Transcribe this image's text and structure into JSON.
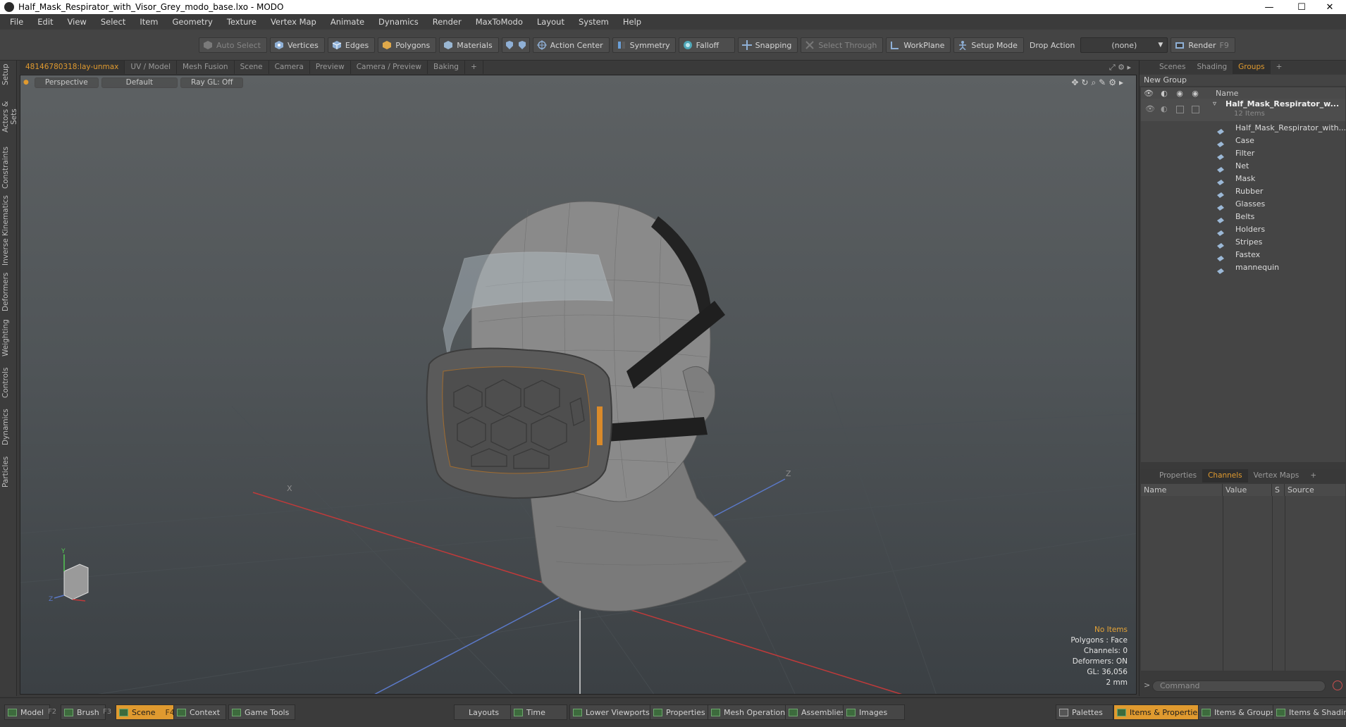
{
  "window": {
    "title": "Half_Mask_Respirator_with_Visor_Grey_modo_base.lxo - MODO",
    "minimize": "—",
    "maximize": "☐",
    "close": "✕"
  },
  "menu": [
    "File",
    "Edit",
    "View",
    "Select",
    "Item",
    "Geometry",
    "Texture",
    "Vertex Map",
    "Animate",
    "Dynamics",
    "Render",
    "MaxToModo",
    "Layout",
    "System",
    "Help"
  ],
  "toolbar": {
    "auto_select": "Auto Select",
    "vertices": "Vertices",
    "edges": "Edges",
    "polygons": "Polygons",
    "materials": "Materials",
    "action_center": "Action Center",
    "symmetry": "Symmetry",
    "falloff": "Falloff",
    "snapping": "Snapping",
    "select_through": "Select Through",
    "workplane": "WorkPlane",
    "setup_mode": "Setup Mode",
    "drop_action_label": "Drop Action",
    "drop_action_value": "(none)",
    "render": "Render",
    "render_key": "F9"
  },
  "left_tabs": [
    "Setup",
    "Actors & Sets",
    "Constraints",
    "Inverse Kinematics",
    "Deformers",
    "Weighting",
    "Controls",
    "Dynamics",
    "Particles"
  ],
  "viewport_tabs": [
    "48146780318:lay-unmax",
    "UV / Model",
    "Mesh Fusion",
    "Scene",
    "Camera",
    "Preview",
    "Camera / Preview",
    "Baking",
    "+"
  ],
  "viewport": {
    "view_mode": "Perspective",
    "shading": "Default",
    "raygl": "Ray GL: Off",
    "status": {
      "items": "No Items",
      "polygons": "Polygons : Face",
      "channels": "Channels: 0",
      "deformers": "Deformers: ON",
      "gl": "GL: 36,056",
      "scale": "2 mm"
    },
    "axis_x_label": "X",
    "axis_z_label": "Z",
    "gizmo_y": "Y",
    "gizmo_z": "Z"
  },
  "right_panel": {
    "top_tabs": [
      "Scenes",
      "Shading",
      "Groups",
      "+"
    ],
    "new_group": "New Group",
    "name_header": "Name",
    "group": {
      "name": "Half_Mask_Respirator_w...",
      "count": "12 Items"
    },
    "items": [
      "Half_Mask_Respirator_with...",
      "Case",
      "Filter",
      "Net",
      "Mask",
      "Rubber",
      "Glasses",
      "Belts",
      "Holders",
      "Stripes",
      "Fastex",
      "mannequin"
    ],
    "bottom_tabs": [
      "Properties",
      "Channels",
      "Vertex Maps",
      "+"
    ],
    "columns": [
      "Name",
      "Value",
      "S",
      "Source"
    ],
    "command_placeholder": "Command",
    "command_prompt": ">"
  },
  "bottom_bar": {
    "model": "Model",
    "model_key": "F2",
    "brush": "Brush",
    "brush_key": "F3",
    "scene": "Scene",
    "scene_key": "F4",
    "context": "Context",
    "game_tools": "Game Tools",
    "layouts": "Layouts",
    "time": "Time",
    "lower_viewports": "Lower Viewports",
    "properties": "Properties",
    "mesh_operations": "Mesh Operations",
    "assemblies": "Assemblies",
    "images": "Images",
    "palettes": "Palettes",
    "items_properties": "Items & Properties",
    "items_groups": "Items & Groups",
    "items_shading": "Items & Shading"
  },
  "colors": {
    "accent": "#e09a2f",
    "panel": "#3a3a3a",
    "viewport_top": "#5d6163",
    "viewport_bottom": "#3b4044"
  }
}
